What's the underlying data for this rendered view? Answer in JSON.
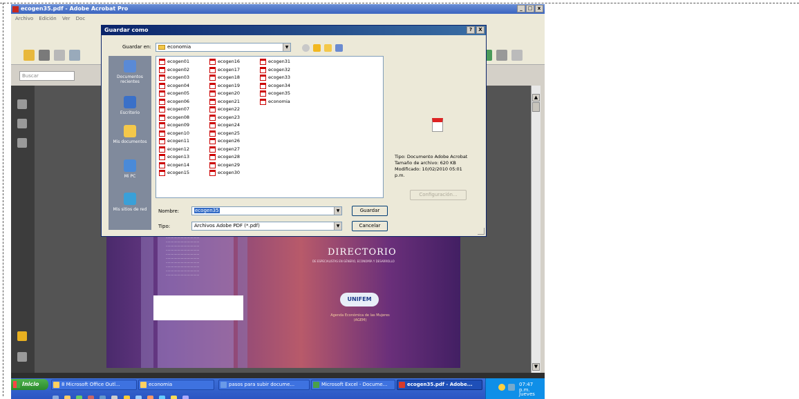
{
  "acrobat": {
    "title": "ecogen35.pdf - Adobe Acrobat Pro",
    "menu": [
      "Archivo",
      "Edición",
      "Ver",
      "Doc"
    ],
    "search_placeholder": "Buscar"
  },
  "dialog": {
    "title": "Guardar como",
    "save_in_label": "Guardar en:",
    "save_in_value": "economia",
    "places": [
      {
        "label": "Documentos recientes",
        "icon": "recent-docs-icon"
      },
      {
        "label": "Escritorio",
        "icon": "desktop-icon"
      },
      {
        "label": "Mis documentos",
        "icon": "my-documents-icon"
      },
      {
        "label": "Mi PC",
        "icon": "my-computer-icon"
      },
      {
        "label": "Mis sitios de red",
        "icon": "network-places-icon"
      }
    ],
    "files_col1": [
      "ecogen01",
      "ecogen02",
      "ecogen03",
      "ecogen04",
      "ecogen05",
      "ecogen06",
      "ecogen07",
      "ecogen08",
      "ecogen09",
      "ecogen10",
      "ecogen11",
      "ecogen12",
      "ecogen13",
      "ecogen14",
      "ecogen15"
    ],
    "files_col2": [
      "ecogen16",
      "ecogen17",
      "ecogen18",
      "ecogen19",
      "ecogen20",
      "ecogen21",
      "ecogen22",
      "ecogen23",
      "ecogen24",
      "ecogen25",
      "ecogen26",
      "ecogen27",
      "ecogen28",
      "ecogen29",
      "ecogen30"
    ],
    "files_col3": [
      "ecogen31",
      "ecogen32",
      "ecogen33",
      "ecogen34",
      "ecogen35",
      "economia"
    ],
    "preview": {
      "type": "Tipo: Documento Adobe Acrobat",
      "size": "Tamaño de archivo: 620 KB",
      "modified": "Modificado: 10/02/2010 05:01",
      "modified_ampm": "p.m."
    },
    "config_button": "Configuración...",
    "name_label": "Nombre:",
    "name_value": "ecogen35",
    "type_label": "Tipo:",
    "type_value": "Archivos Adobe PDF (*.pdf)",
    "save_button": "Guardar",
    "cancel_button": "Cancelar",
    "help_button": "?",
    "close_button": "X"
  },
  "page": {
    "title": "DIRECTORIO",
    "subtitle": "DE ESPECIALISTAS EN GÉNERO, ECONOMÍA Y DESARROLLO",
    "logo": "UNIFEM",
    "agency": "Agenda Económica de las Mujeres (AGEM)"
  },
  "taskbar": {
    "start": "Inicio",
    "tasks": [
      "8 Microsoft Office Outl...",
      "economia",
      "pasos para subir docume...",
      "Microsoft Excel - Docume...",
      "ecogen35.pdf - Adobe..."
    ],
    "clock": "07:47 p.m.",
    "day": "Jueves"
  }
}
